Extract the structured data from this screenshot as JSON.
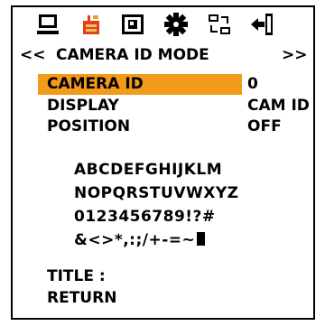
{
  "icons": [
    "monitor-icon",
    "camera-icon",
    "tv-icon",
    "gear-icon",
    "network-icon",
    "exit-icon"
  ],
  "header": {
    "left_nav": "<<",
    "title": "CAMERA ID MODE",
    "right_nav": ">>"
  },
  "menu": [
    {
      "label": "CAMERA ID",
      "value": "0",
      "selected": true
    },
    {
      "label": "DISPLAY",
      "value": "CAM ID",
      "selected": false
    },
    {
      "label": "POSITION",
      "value": "OFF",
      "selected": false
    }
  ],
  "charset": {
    "row1": "ABCDEFGHIJKLM",
    "row2": "NOPQRSTUVWXYZ",
    "row3": "0123456789!?#",
    "row4": "&<>*,:;/+-=~"
  },
  "title_label": "TITLE :",
  "return_label": "RETURN",
  "colors": {
    "highlight": "#f29a1a",
    "icon_accent": "#f0a020",
    "icon_red": "#e04020"
  }
}
